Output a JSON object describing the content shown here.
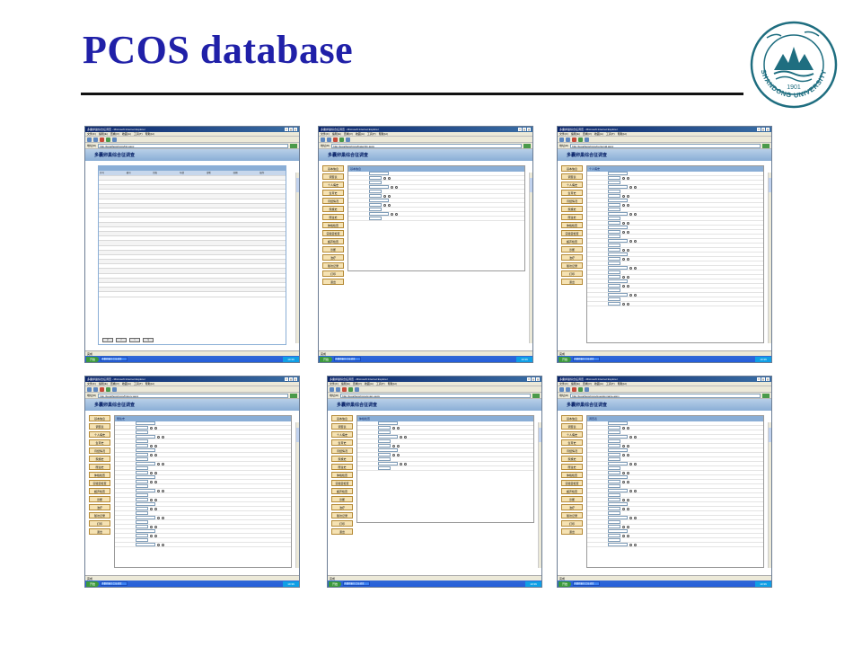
{
  "slide": {
    "title": "PCOS database",
    "logo": {
      "org": "SHANDONG UNIVERSITY",
      "year": "1901",
      "colors": {
        "primary": "#1f6e80"
      }
    }
  },
  "colors": {
    "title": "#2020a8",
    "titlebar": "#0a246a",
    "band": "#8aaed6",
    "nav_button": "#f5e2b3"
  },
  "browser": {
    "window_title": "多囊卵巢综合征调查 - Microsoft Internet Explorer",
    "menu": [
      "文件(F)",
      "编辑(E)",
      "查看(V)",
      "收藏(A)",
      "工具(T)",
      "帮助(H)"
    ],
    "address_label": "地址(D)",
    "urls": [
      "http://localhost/pcos/list.aspx",
      "http://localhost/pcos/baseinfo.aspx",
      "http://localhost/pcos/personal.aspx",
      "http://localhost/pcos/history.aspx",
      "http://localhost/pcos/exam.aspx",
      "http://localhost/pcos/questionnaire.aspx"
    ],
    "go_label": "转到",
    "status": "完成",
    "start_label": "开始",
    "clock": "10:36"
  },
  "app": {
    "header": "多囊卵巢综合征调查",
    "nav": [
      "基本信息",
      "调查表",
      "个人病史",
      "生育史",
      "月经情况",
      "家族史",
      "既往史",
      "体格检查",
      "实验室检查",
      "超声检查",
      "诊断",
      "治疗",
      "随访记录",
      "打印",
      "退出"
    ],
    "list_headers": [
      "序号",
      "编号",
      "姓名",
      "年龄",
      "诊断",
      "日期",
      "操作"
    ],
    "list_rows": 26
  }
}
